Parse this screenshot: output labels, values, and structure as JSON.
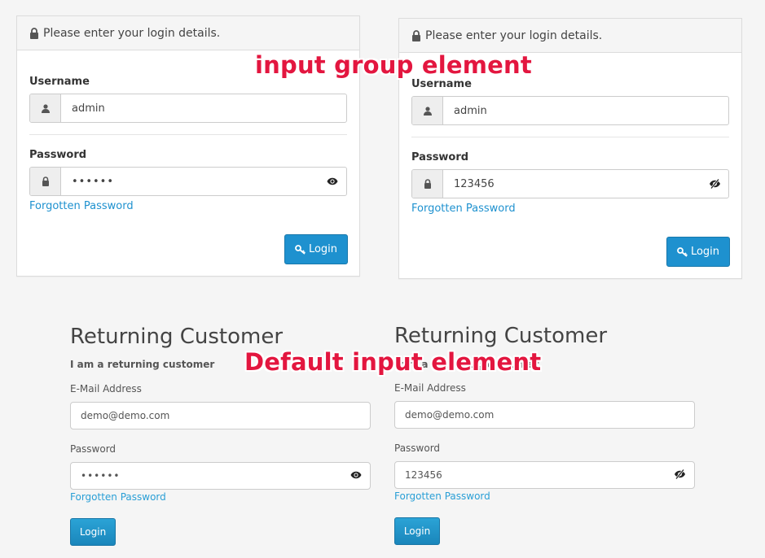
{
  "colors": {
    "accent": "#1e91cf",
    "annotation": "#e3163f"
  },
  "annotations": {
    "top": "input group element",
    "bottom": "Default input element"
  },
  "admin_left": {
    "heading": "Please enter your login details.",
    "username_label": "Username",
    "username_value": "admin",
    "password_label": "Password",
    "password_value": "••••••",
    "forgot": "Forgotten Password",
    "login": "Login",
    "eye_state": "visible-eye-icon"
  },
  "admin_right": {
    "heading": "Please enter your login details.",
    "username_label": "Username",
    "username_value": "admin",
    "password_label": "Password",
    "password_value": "123456",
    "forgot": "Forgotten Password",
    "login": "Login",
    "eye_state": "slashed-eye-icon"
  },
  "customer_left": {
    "title": "Returning Customer",
    "subtitle": "I am a returning customer",
    "email_label": "E-Mail Address",
    "email_value": "demo@demo.com",
    "password_label": "Password",
    "password_value": "••••••",
    "forgot": "Forgotten Password",
    "login": "Login"
  },
  "customer_right": {
    "title": "Returning Customer",
    "subtitle": "I am a returning customer",
    "email_label": "E-Mail Address",
    "email_value": "demo@demo.com",
    "password_label": "Password",
    "password_value": "123456",
    "forgot": "Forgotten Password",
    "login": "Login"
  }
}
